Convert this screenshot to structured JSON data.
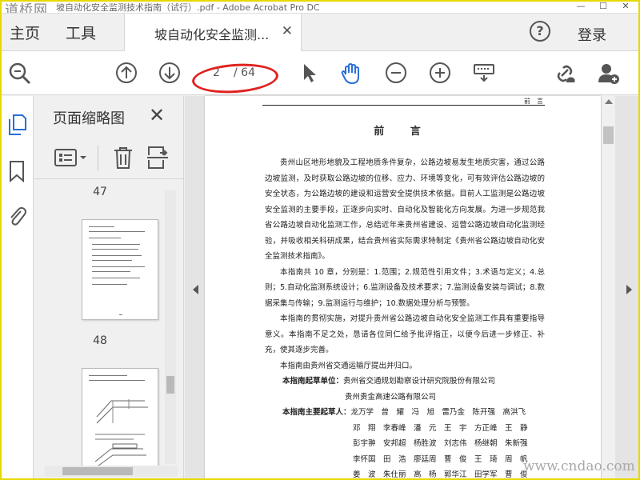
{
  "window": {
    "watermark_logo": "道桥网",
    "title": "坡自动化安全监测技术指南（试行）.pdf - Adobe Acrobat Pro DC",
    "controls": [
      "—",
      "☐",
      "✕"
    ]
  },
  "tabs": {
    "home": "主页",
    "tools": "工具",
    "document": "坡自动化安全监测...",
    "login": "登录"
  },
  "toolbar": {
    "current_page": "2",
    "total_pages": "/ 64"
  },
  "thumbnail_pane": {
    "title": "页面缩略图",
    "pages": [
      {
        "number": "47"
      },
      {
        "number": "48"
      }
    ]
  },
  "document": {
    "header_right": "前　言",
    "title": "前 言",
    "paragraphs": [
      "贵州山区地形地貌及工程地质条件复杂，公路边坡易发生地质灾害，通过公路边坡监测，及时获取公路边坡的位移、应力、环境等变化，可有效评估公路边坡的安全状态，为公路边坡的建设和运营安全提供技术依据。目前人工监测是公路边坡安全监测的主要手段，正逐步向实时、自动化及智能化方向发展。为进一步规范我省公路边坡自动化监测工作，总结近年来贵州省建设、运营公路边坡自动化监测经验，并吸收相关科研成果，结合贵州省实际需求特制定《贵州省公路边坡自动化安全监测技术指南》。",
      "本指南共 10 章，分别是：1.范围；2.规范性引用文件；3.术语与定义；4.总则；5.自动化监测系统设计；6.监测设备及技术要求；7.监测设备安装与调试；8.数据采集与传输；9.监测运行与维护；10.数据处理分析与预警。",
      "本指南的贯彻实施，对提升贵州省公路边坡自动化安全监测工作具有重要指导意义。本指南不足之处，恳请各位同仁给予批评指正，以便今后进一步修正、补充，使其逐步完善。",
      "本指南由贵州省交通运输厅提出并归口。"
    ],
    "drafting_units_label": "本指南起草单位：",
    "drafting_units": [
      "贵州省交通规划勘察设计研究院股份有限公司",
      "贵州贵金高速公路有限公司"
    ],
    "drafters_label": "本指南主要起草人：",
    "drafters_lines": [
      "龙万学　曾　耀　冯　旭　雷乃金　陈开强　高洪飞",
      "邓　翔　李春峰　潘　元　王　宇　方正峰　王　静",
      "彭宇翀　安邦超　杨胜波　刘志伟　杨继朝　朱新强",
      "李怀国　田　浩　廖廷周　曹　俊　王　琦　周　帆",
      "姜　波　朱仕丽　高　杨　郭华江　田学军　曹　俊"
    ]
  },
  "site_watermark": "www.cndao.com",
  "colors": {
    "frame": "#e6d800",
    "annotation_circle": "#e0221f",
    "active_icon": "#2a6fd6",
    "icon_gray": "#555555"
  }
}
